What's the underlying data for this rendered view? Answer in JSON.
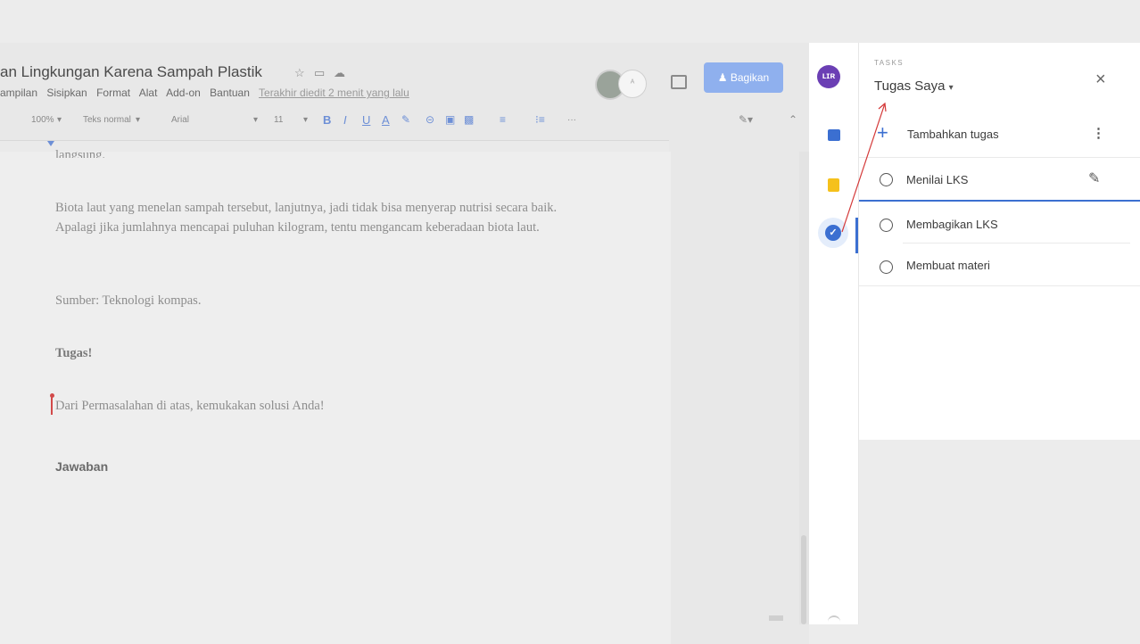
{
  "document": {
    "title": "an Lingkungan Karena Sampah Plastik",
    "menu": [
      "ampilan",
      "Sisipkan",
      "Format",
      "Alat",
      "Add-on",
      "Bantuan"
    ],
    "last_edit": "Terakhir diedit 2 menit yang lalu",
    "toolbar": {
      "zoom": "100%",
      "style": "Teks normal",
      "font": "Arial",
      "font_size": "11",
      "bold": "B",
      "italic": "I",
      "underline": "U",
      "text_color": "A",
      "more": "···"
    },
    "partial_line": "langsung.",
    "paragraph1": "Biota laut yang menelan sampah tersebut, lanjutnya, jadi tidak bisa menyerap nutrisi secara baik. Apalagi jika jumlahnya mencapai puluhan kilogram, tentu mengancam keberadaan biota laut.",
    "source": "Sumber: Teknologi kompas.",
    "heading_task": "Tugas!",
    "question": "Dari Permasalahan di atas, kemukakan solusi Anda!",
    "answer_heading": "Jawaban"
  },
  "share": {
    "label": "Bagikan"
  },
  "tasks_panel": {
    "eyebrow": "TASKS",
    "list_name": "Tugas Saya",
    "add_label": "Tambahkan tugas",
    "tasks": [
      {
        "label": "Menilai LKS"
      },
      {
        "label": "Membagikan LKS"
      },
      {
        "label": "Membuat materi"
      }
    ]
  },
  "colors": {
    "accent": "#3b6fd1",
    "share_button": "#8fb0ee",
    "annotation_arrow": "#d43a3a"
  }
}
